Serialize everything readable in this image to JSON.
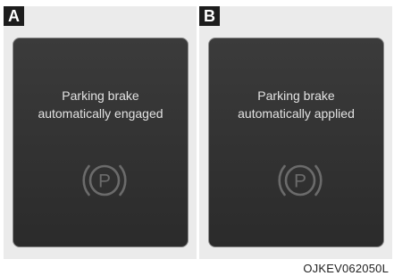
{
  "panels": [
    {
      "label": "A",
      "message_line1": "Parking brake",
      "message_line2": "automatically engaged",
      "icon": "parking-brake-icon",
      "icon_letter": "P"
    },
    {
      "label": "B",
      "message_line1": "Parking brake",
      "message_line2": "automatically applied",
      "icon": "parking-brake-icon",
      "icon_letter": "P"
    }
  ],
  "caption": "OJKEV062050L",
  "colors": {
    "screen_background": "#333333",
    "screen_text": "#e2e2e2",
    "icon_stroke": "#6b6b6b",
    "badge_background": "#1d1d1d",
    "panel_background": "#ebebeb"
  }
}
